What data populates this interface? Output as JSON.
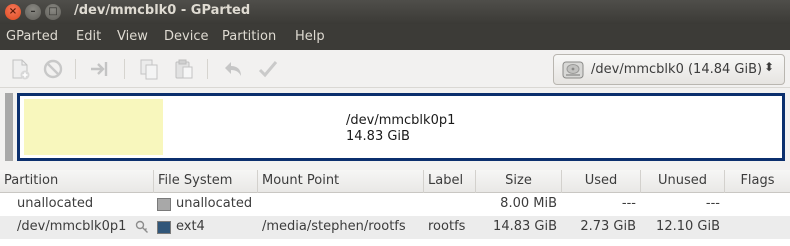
{
  "window": {
    "title": "/dev/mmcblk0 - GParted",
    "close_glyph": "×",
    "minimize_glyph": "–",
    "maximize_glyph": "□"
  },
  "menubar": {
    "items": [
      "GParted",
      "Edit",
      "View",
      "Device",
      "Partition",
      "Help"
    ]
  },
  "toolbar": {
    "buttons": [
      "new-partition",
      "delete",
      "resize-move",
      "copy",
      "paste",
      "undo",
      "apply"
    ],
    "device_combo": {
      "label": "/dev/mmcblk0  (14.84 GiB)",
      "arrow": "⬍"
    }
  },
  "disk_map": {
    "partition_name": "/dev/mmcblk0p1",
    "partition_size": "14.83 GiB",
    "used_fraction": 0.184
  },
  "table": {
    "headers": [
      "Partition",
      "File System",
      "Mount Point",
      "Label",
      "Size",
      "Used",
      "Unused",
      "Flags"
    ],
    "rows": [
      {
        "partition": "unallocated",
        "filesystem": "unallocated",
        "fs_color": "#a8a8a8",
        "mount_point": "",
        "label": "",
        "size": "8.00 MiB",
        "used": "---",
        "unused": "---",
        "flags": ""
      },
      {
        "partition": "/dev/mmcblk0p1",
        "filesystem": "ext4",
        "fs_color": "#315679",
        "mount_point": "/media/stephen/rootfs",
        "label": "rootfs",
        "size": "14.83 GiB",
        "used": "2.73 GiB",
        "unused": "12.10 GiB",
        "flags": ""
      }
    ]
  },
  "colors": {
    "titlebar": "#3c3b37",
    "menubar": "#3c3b37",
    "map_border": "#0b2f6d",
    "map_used": "#f8f7bd",
    "selected_row": "#ececec"
  }
}
